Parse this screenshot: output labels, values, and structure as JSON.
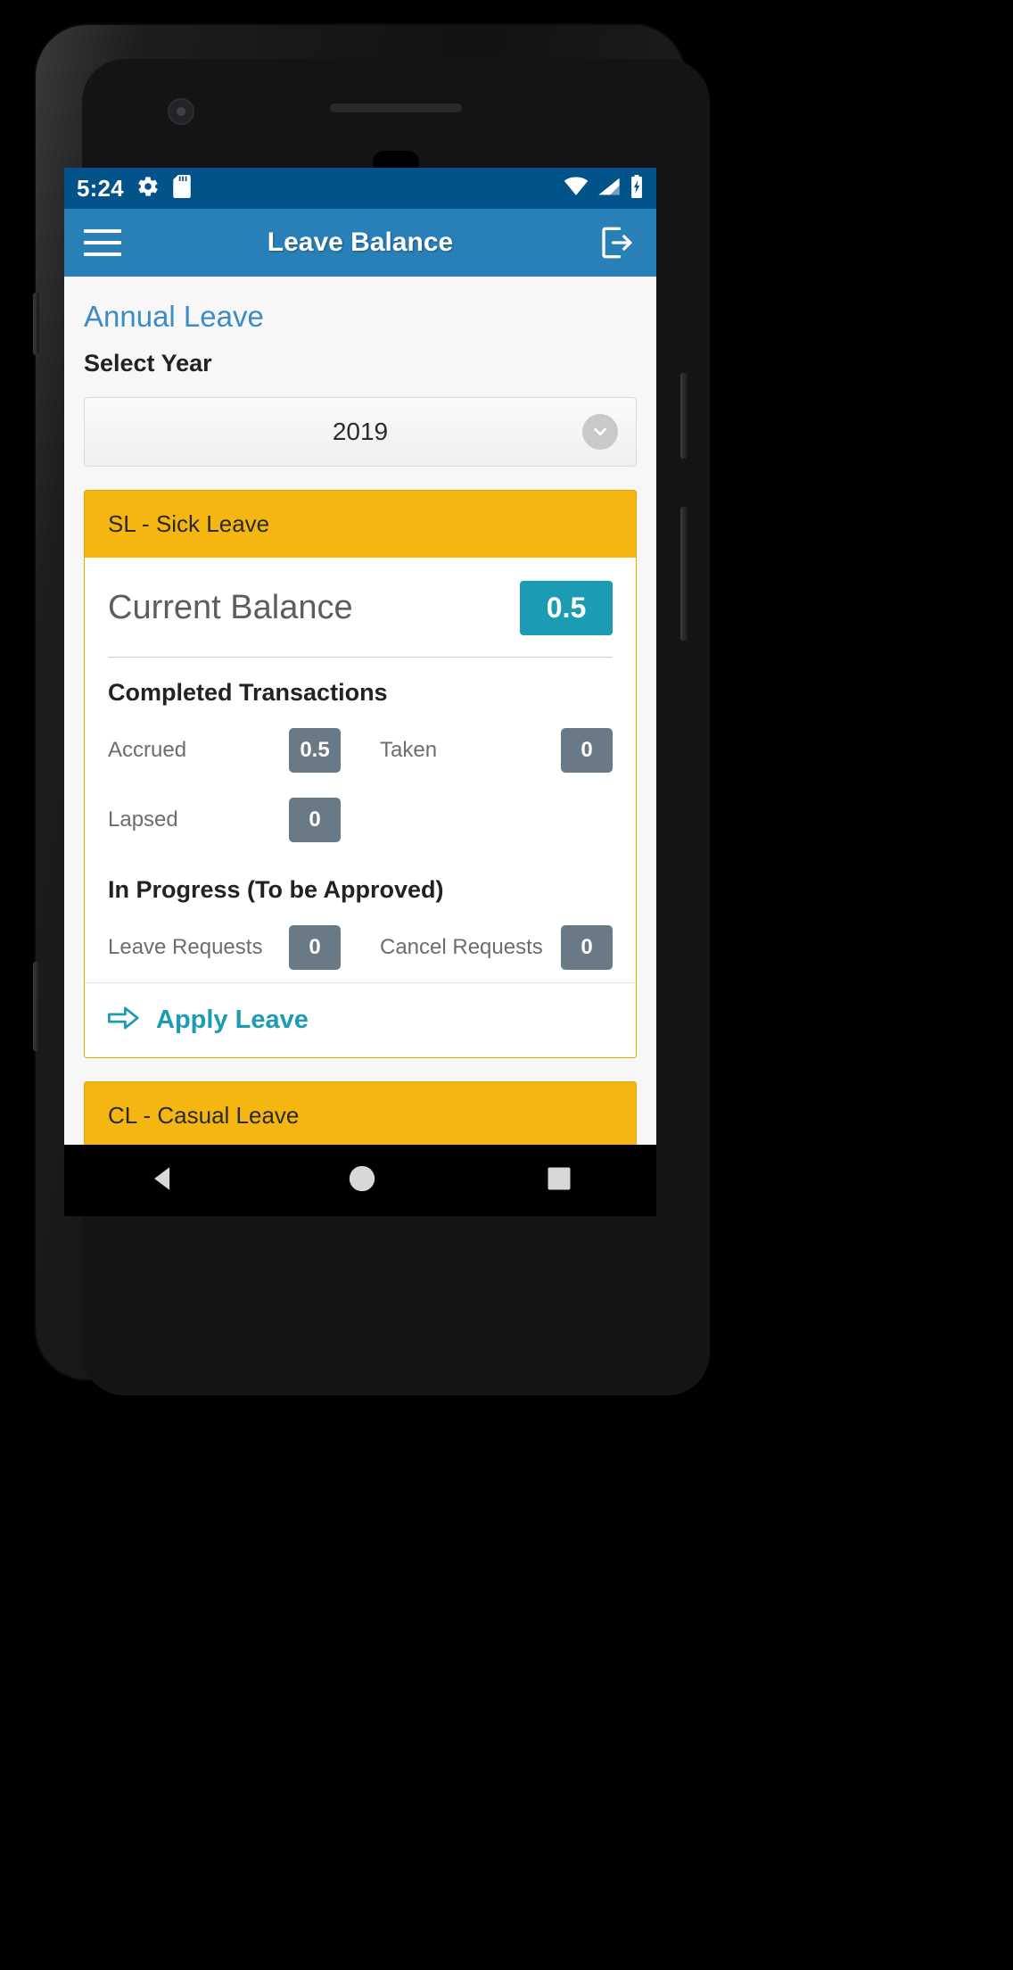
{
  "status_bar": {
    "clock": "5:24",
    "left_icons": [
      "gear-icon",
      "sd-card-icon"
    ],
    "right_icons": [
      "wifi-icon",
      "signal-icon",
      "battery-charging-icon"
    ],
    "background": "#02538A"
  },
  "app_bar": {
    "menu_icon": "hamburger-menu-icon",
    "title": "Leave Balance",
    "logout_icon": "logout-icon",
    "background": "#2980B9"
  },
  "content": {
    "section_title": "Annual Leave",
    "select_year_label": "Select Year",
    "year_dropdown": {
      "value": "2019",
      "chevron_icon": "chevron-down-icon"
    }
  },
  "cards": [
    {
      "header": "SL - Sick Leave",
      "header_color": "#F5B612",
      "current_balance_label": "Current Balance",
      "current_balance_value": "0.5",
      "balance_badge_color": "#1C9CB4",
      "completed_title": "Completed Transactions",
      "completed_stats": [
        {
          "label": "Accrued",
          "value": "0.5"
        },
        {
          "label": "Taken",
          "value": "0"
        },
        {
          "label": "Lapsed",
          "value": "0"
        }
      ],
      "in_progress_title": "In Progress (To be Approved)",
      "in_progress_stats": [
        {
          "label": "Leave Requests",
          "value": "0"
        },
        {
          "label": "Cancel Requests",
          "value": "0"
        }
      ],
      "apply_label": "Apply Leave",
      "apply_icon": "arrow-right-icon",
      "apply_color": "#1C9CB4"
    },
    {
      "header": "CL - Casual Leave",
      "header_color": "#F5B612"
    }
  ],
  "nav_bar": {
    "back_icon": "triangle-back-icon",
    "home_icon": "circle-home-icon",
    "recents_icon": "square-recents-icon"
  }
}
